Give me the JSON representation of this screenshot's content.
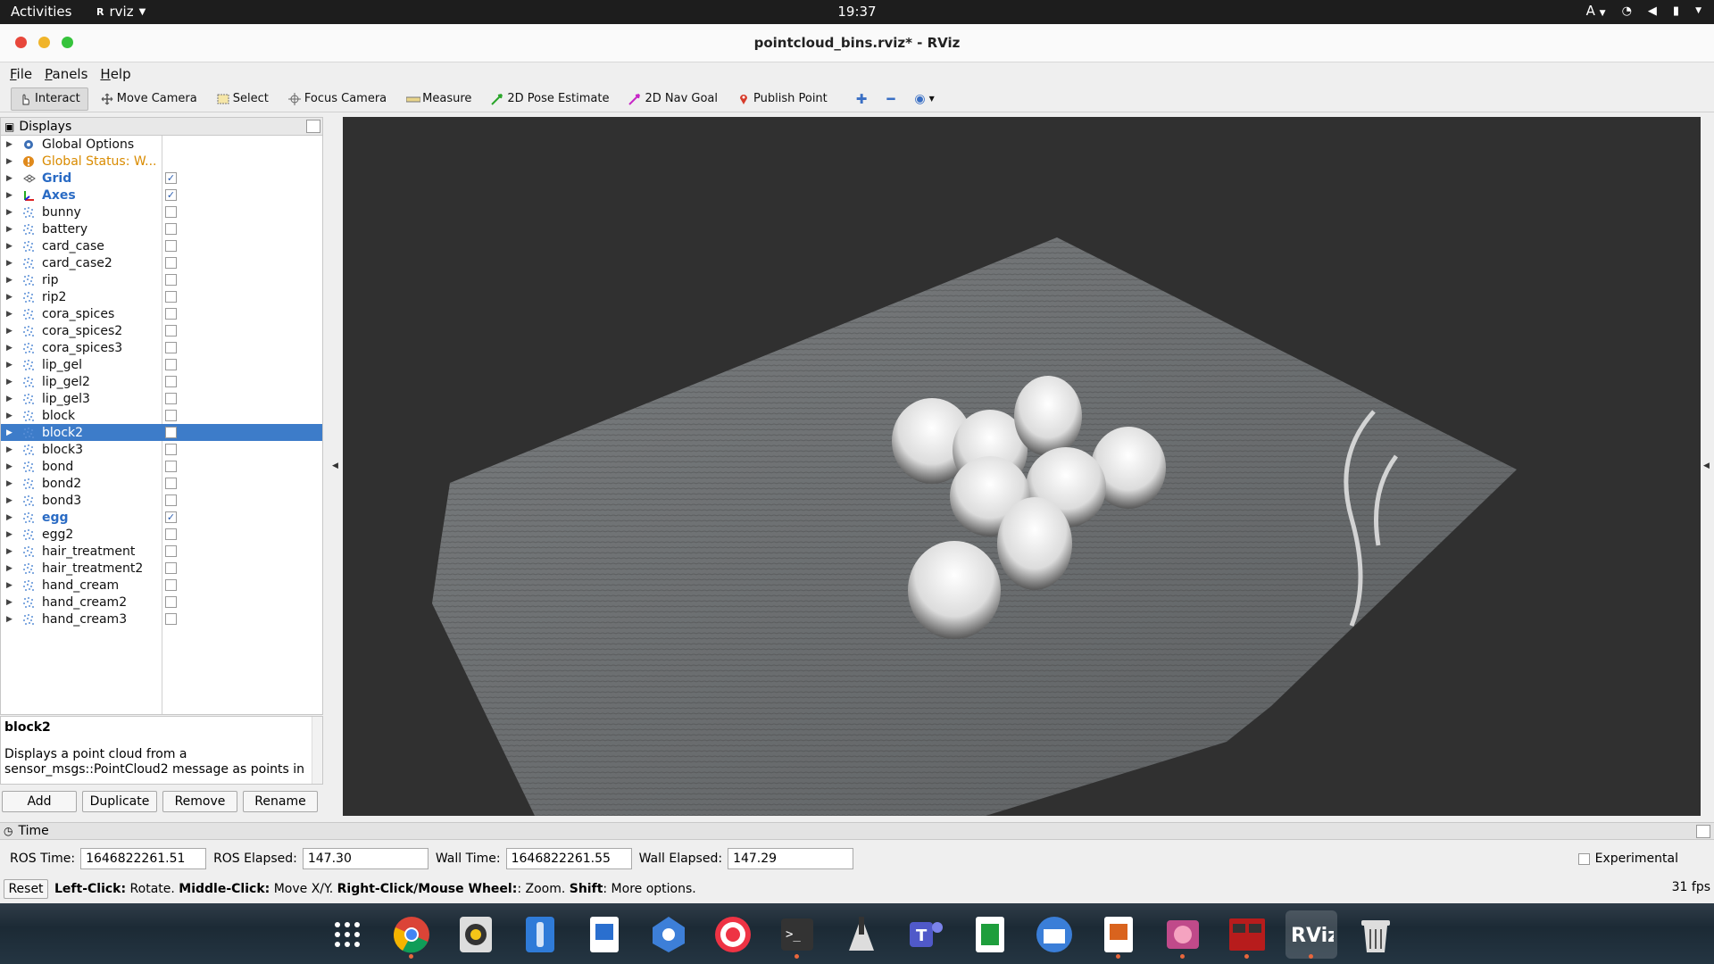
{
  "topbar": {
    "activities": "Activities",
    "app_name": "rviz",
    "clock": "19:37",
    "lang": "A"
  },
  "window": {
    "title": "pointcloud_bins.rviz* - RViz",
    "colors": {
      "close": "#e8473b",
      "minimize": "#f0b42a",
      "maximize": "#36c33c"
    }
  },
  "menu": [
    "File",
    "Panels",
    "Help"
  ],
  "toolbar": {
    "interact": "Interact",
    "move_camera": "Move Camera",
    "select": "Select",
    "focus_camera": "Focus Camera",
    "measure": "Measure",
    "pose_estimate": "2D Pose Estimate",
    "nav_goal": "2D Nav Goal",
    "publish_point": "Publish Point"
  },
  "displays": {
    "title": "Displays",
    "items": [
      {
        "label": "Global Options",
        "icon": "gear-icon",
        "checkbox": false,
        "state": "normal"
      },
      {
        "label": "Global Status: W...",
        "icon": "warning-icon",
        "checkbox": false,
        "state": "warn"
      },
      {
        "label": "Grid",
        "icon": "grid-icon",
        "checkbox": true,
        "checked": true,
        "state": "bold"
      },
      {
        "label": "Axes",
        "icon": "axes-icon",
        "checkbox": true,
        "checked": true,
        "state": "bold"
      },
      {
        "label": "bunny",
        "icon": "pointcloud-icon",
        "checkbox": true,
        "checked": false,
        "state": "normal"
      },
      {
        "label": "battery",
        "icon": "pointcloud-icon",
        "checkbox": true,
        "checked": false,
        "state": "normal"
      },
      {
        "label": "card_case",
        "icon": "pointcloud-icon",
        "checkbox": true,
        "checked": false,
        "state": "normal"
      },
      {
        "label": "card_case2",
        "icon": "pointcloud-icon",
        "checkbox": true,
        "checked": false,
        "state": "normal"
      },
      {
        "label": "rip",
        "icon": "pointcloud-icon",
        "checkbox": true,
        "checked": false,
        "state": "normal"
      },
      {
        "label": "rip2",
        "icon": "pointcloud-icon",
        "checkbox": true,
        "checked": false,
        "state": "normal"
      },
      {
        "label": "cora_spices",
        "icon": "pointcloud-icon",
        "checkbox": true,
        "checked": false,
        "state": "normal"
      },
      {
        "label": "cora_spices2",
        "icon": "pointcloud-icon",
        "checkbox": true,
        "checked": false,
        "state": "normal"
      },
      {
        "label": "cora_spices3",
        "icon": "pointcloud-icon",
        "checkbox": true,
        "checked": false,
        "state": "normal"
      },
      {
        "label": "lip_gel",
        "icon": "pointcloud-icon",
        "checkbox": true,
        "checked": false,
        "state": "normal"
      },
      {
        "label": "lip_gel2",
        "icon": "pointcloud-icon",
        "checkbox": true,
        "checked": false,
        "state": "normal"
      },
      {
        "label": "lip_gel3",
        "icon": "pointcloud-icon",
        "checkbox": true,
        "checked": false,
        "state": "normal"
      },
      {
        "label": "block",
        "icon": "pointcloud-icon",
        "checkbox": true,
        "checked": false,
        "state": "normal"
      },
      {
        "label": "block2",
        "icon": "pointcloud-icon",
        "checkbox": true,
        "checked": false,
        "state": "selected"
      },
      {
        "label": "block3",
        "icon": "pointcloud-icon",
        "checkbox": true,
        "checked": false,
        "state": "normal"
      },
      {
        "label": "bond",
        "icon": "pointcloud-icon",
        "checkbox": true,
        "checked": false,
        "state": "normal"
      },
      {
        "label": "bond2",
        "icon": "pointcloud-icon",
        "checkbox": true,
        "checked": false,
        "state": "normal"
      },
      {
        "label": "bond3",
        "icon": "pointcloud-icon",
        "checkbox": true,
        "checked": false,
        "state": "normal"
      },
      {
        "label": "egg",
        "icon": "pointcloud-icon",
        "checkbox": true,
        "checked": true,
        "state": "bold"
      },
      {
        "label": "egg2",
        "icon": "pointcloud-icon",
        "checkbox": true,
        "checked": false,
        "state": "normal"
      },
      {
        "label": "hair_treatment",
        "icon": "pointcloud-icon",
        "checkbox": true,
        "checked": false,
        "state": "normal"
      },
      {
        "label": "hair_treatment2",
        "icon": "pointcloud-icon",
        "checkbox": true,
        "checked": false,
        "state": "normal"
      },
      {
        "label": "hand_cream",
        "icon": "pointcloud-icon",
        "checkbox": true,
        "checked": false,
        "state": "normal"
      },
      {
        "label": "hand_cream2",
        "icon": "pointcloud-icon",
        "checkbox": true,
        "checked": false,
        "state": "normal"
      },
      {
        "label": "hand_cream3",
        "icon": "pointcloud-icon",
        "checkbox": true,
        "checked": false,
        "state": "normal"
      }
    ],
    "description_title": "block2",
    "description_text": "Displays a point cloud from a sensor_msgs::PointCloud2 message as points in",
    "buttons": {
      "add": "Add",
      "duplicate": "Duplicate",
      "remove": "Remove",
      "rename": "Rename"
    }
  },
  "time": {
    "title": "Time",
    "ros_time_label": "ROS Time:",
    "ros_time": "1646822261.51",
    "ros_elapsed_label": "ROS Elapsed:",
    "ros_elapsed": "147.30",
    "wall_time_label": "Wall Time:",
    "wall_time": "1646822261.55",
    "wall_elapsed_label": "Wall Elapsed:",
    "wall_elapsed": "147.29",
    "experimental": "Experimental"
  },
  "status": {
    "reset": "Reset",
    "hint_left_key": "Left-Click:",
    "hint_left": " Rotate. ",
    "hint_middle_key": "Middle-Click:",
    "hint_middle": " Move X/Y. ",
    "hint_right_key": "Right-Click/Mouse Wheel:",
    "hint_right": ": Zoom. ",
    "hint_shift_key": "Shift",
    "hint_shift": ": More options.",
    "fps": "31 fps"
  },
  "dock": [
    "app-grid-icon",
    "chrome-icon",
    "rhythmbox-icon",
    "files-icon",
    "writer-icon",
    "settings-icon",
    "help-icon",
    "terminal-icon",
    "inkscape-icon",
    "teams-icon",
    "calc-icon",
    "thunderbird-icon",
    "impress-icon",
    "image-viewer-icon",
    "terminator-icon",
    "rviz-icon",
    "trash-icon"
  ]
}
